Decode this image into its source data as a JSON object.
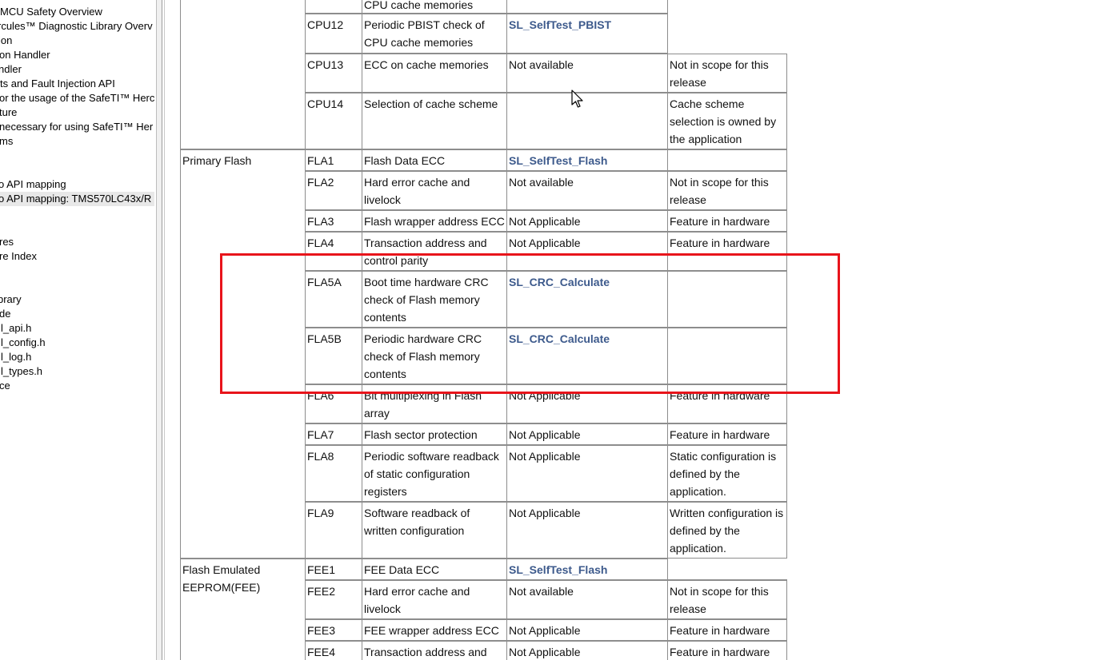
{
  "nav": {
    "items": [
      {
        "label": "MCU Safety Overview"
      },
      {
        "label": "rcules™ Diagnostic Library Overv"
      },
      {
        "label": "ion"
      },
      {
        "label": "on Handler"
      },
      {
        "label": "ndler"
      },
      {
        "label": "ts and Fault Injection API"
      },
      {
        "label": "or the usage of the SafeTI™ Herc"
      },
      {
        "label": "ture"
      },
      {
        "label": "necessary for using SafeTI™ Her"
      },
      {
        "label": "ms"
      },
      {
        "label": "o API mapping"
      },
      {
        "label": "o API mapping: TMS570LC43x/R"
      },
      {
        "label": "res"
      },
      {
        "label": "re Index"
      },
      {
        "label": "brary"
      },
      {
        "label": "de"
      },
      {
        "label": "l_api.h"
      },
      {
        "label": "l_config.h"
      },
      {
        "label": "l_log.h"
      },
      {
        "label": "l_types.h"
      },
      {
        "label": "ce"
      }
    ]
  },
  "table": {
    "groups": [
      {
        "label": "Primary Flash"
      },
      {
        "label": "Flash Emulated EEPROM(FEE)"
      }
    ],
    "rows": [
      {
        "id": "",
        "desc": "CPU cache memories",
        "api": "",
        "api_link": false,
        "note": ""
      },
      {
        "id": "CPU12",
        "desc": "Periodic PBIST check of CPU cache memories",
        "api": "SL_SelfTest_PBIST",
        "api_link": true,
        "note": ""
      },
      {
        "id": "CPU13",
        "desc": "ECC on cache memories",
        "api": "Not available",
        "api_link": false,
        "note": "Not in scope for this release"
      },
      {
        "id": "CPU14",
        "desc": "Selection of cache scheme",
        "api": "",
        "api_link": false,
        "note": "Cache scheme selection is owned by the application"
      },
      {
        "id": "FLA1",
        "desc": "Flash Data ECC",
        "api": "SL_SelfTest_Flash",
        "api_link": true,
        "note": ""
      },
      {
        "id": "FLA2",
        "desc": "Hard error cache and livelock",
        "api": "Not available",
        "api_link": false,
        "note": "Not in scope for this release"
      },
      {
        "id": "FLA3",
        "desc": "Flash wrapper address ECC",
        "api": "Not Applicable",
        "api_link": false,
        "note": "Feature in hardware"
      },
      {
        "id": "FLA4",
        "desc": "Transaction address and control parity",
        "api": "Not Applicable",
        "api_link": false,
        "note": "Feature in hardware"
      },
      {
        "id": "FLA5A",
        "desc": "Boot time hardware CRC check of Flash memory contents",
        "api": "SL_CRC_Calculate",
        "api_link": true,
        "note": ""
      },
      {
        "id": "FLA5B",
        "desc": "Periodic hardware CRC check of Flash memory contents",
        "api": "SL_CRC_Calculate",
        "api_link": true,
        "note": ""
      },
      {
        "id": "FLA6",
        "desc": "Bit multiplexing in Flash array",
        "api": "Not Applicable",
        "api_link": false,
        "note": "Feature in hardware"
      },
      {
        "id": "FLA7",
        "desc": "Flash sector protection",
        "api": "Not Applicable",
        "api_link": false,
        "note": "Feature in hardware"
      },
      {
        "id": "FLA8",
        "desc": "Periodic software readback of static configuration registers",
        "api": "Not Applicable",
        "api_link": false,
        "note": "Static configuration is defined by the application."
      },
      {
        "id": "FLA9",
        "desc": "Software readback of written configuration",
        "api": "Not Applicable",
        "api_link": false,
        "note": "Written configuration is defined by the application."
      },
      {
        "id": "FEE1",
        "desc": "FEE Data ECC",
        "api": "SL_SelfTest_Flash",
        "api_link": true,
        "note": ""
      },
      {
        "id": "FEE2",
        "desc": "Hard error cache and livelock",
        "api": "Not available",
        "api_link": false,
        "note": "Not in scope for this release"
      },
      {
        "id": "FEE3",
        "desc": "FEE wrapper address ECC",
        "api": "Not Applicable",
        "api_link": false,
        "note": "Feature in hardware"
      },
      {
        "id": "FEE4",
        "desc": "Transaction address and",
        "api": "Not Applicable",
        "api_link": false,
        "note": "Feature in hardware"
      }
    ]
  },
  "colors": {
    "link": "#3d5a8c",
    "highlight": "#e8141b",
    "border": "#8d8d8d"
  }
}
